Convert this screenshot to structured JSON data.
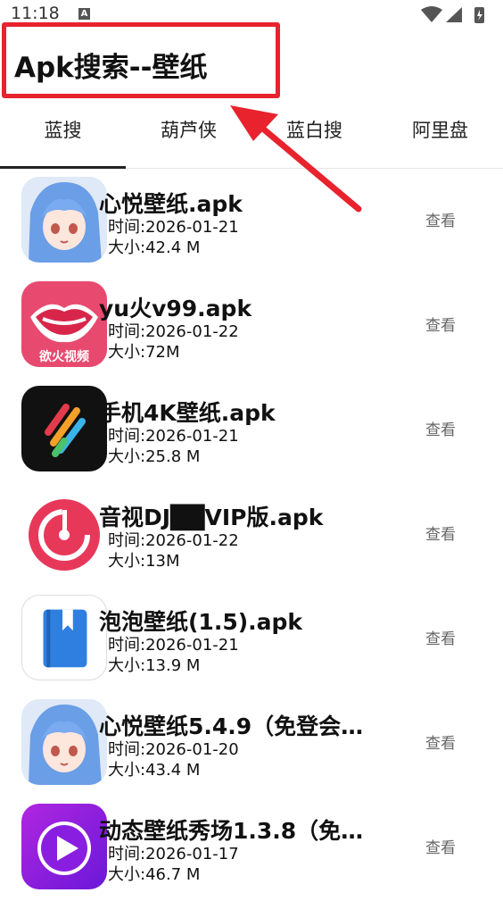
{
  "status_bar": {
    "time": "11:18",
    "notification": "A"
  },
  "header": {
    "title": "Apk搜索--壁纸"
  },
  "tabs": [
    {
      "label": "蓝搜",
      "active": true
    },
    {
      "label": "葫芦侠",
      "active": false
    },
    {
      "label": "蓝白搜",
      "active": false
    },
    {
      "label": "阿里盘",
      "active": false
    }
  ],
  "apps": [
    {
      "name": "心悦壁纸.apk",
      "time": "时间:2026-01-21",
      "size": "大小:42.4 M",
      "action": "查看",
      "icon": "anime-girl-icon"
    },
    {
      "name": "yu火v99.apk",
      "time": "时间:2026-01-22",
      "size": "大小:72M",
      "action": "查看",
      "icon": "lips-icon"
    },
    {
      "name": "手机4K壁纸.apk",
      "time": "时间:2026-01-21",
      "size": "大小:25.8 M",
      "action": "查看",
      "icon": "color-stripes-icon"
    },
    {
      "name": "音视DJ██VIP版.apk",
      "time": "时间:2026-01-22",
      "size": "大小:13M",
      "action": "查看",
      "icon": "music-disc-icon"
    },
    {
      "name": "泡泡壁纸(1.5).apk",
      "time": "时间:2026-01-21",
      "size": "大小:13.9 M",
      "action": "查看",
      "icon": "book-icon"
    },
    {
      "name": "心悦壁纸5.4.9（免登会…",
      "time": "时间:2026-01-20",
      "size": "大小:43.4 M",
      "action": "查看",
      "icon": "anime-girl-icon"
    },
    {
      "name": "动态壁纸秀场1.3.8（免…",
      "time": "时间:2026-01-17",
      "size": "大小:46.7 M",
      "action": "查看",
      "icon": "play-icon"
    }
  ],
  "icon_labels": {
    "lips": "欲火视频"
  },
  "colors": {
    "highlight": "#e8232d",
    "text": "#111111",
    "muted": "#666666"
  }
}
